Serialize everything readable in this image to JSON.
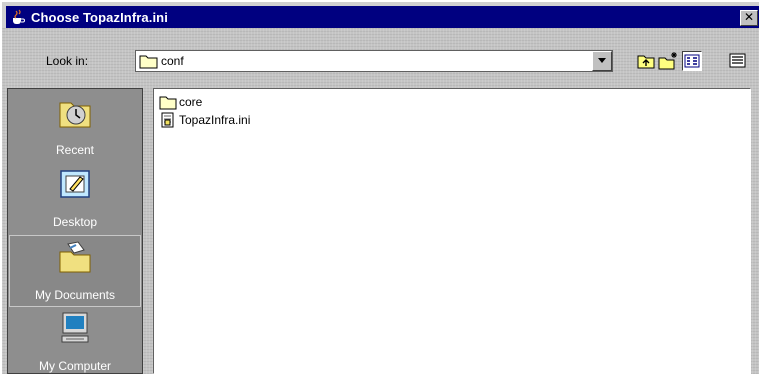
{
  "window": {
    "title": "Choose TopazInfra.ini"
  },
  "toolbar": {
    "look_in_label": "Look in:",
    "look_in_value": "conf"
  },
  "places": [
    {
      "label": "Recent"
    },
    {
      "label": "Desktop"
    },
    {
      "label": "My Documents"
    },
    {
      "label": "My Computer"
    }
  ],
  "files": [
    {
      "name": "core",
      "type": "folder"
    },
    {
      "name": "TopazInfra.ini",
      "type": "file"
    }
  ],
  "colors": {
    "title_bar": "#000080",
    "places_bg": "#8e8e8e"
  }
}
